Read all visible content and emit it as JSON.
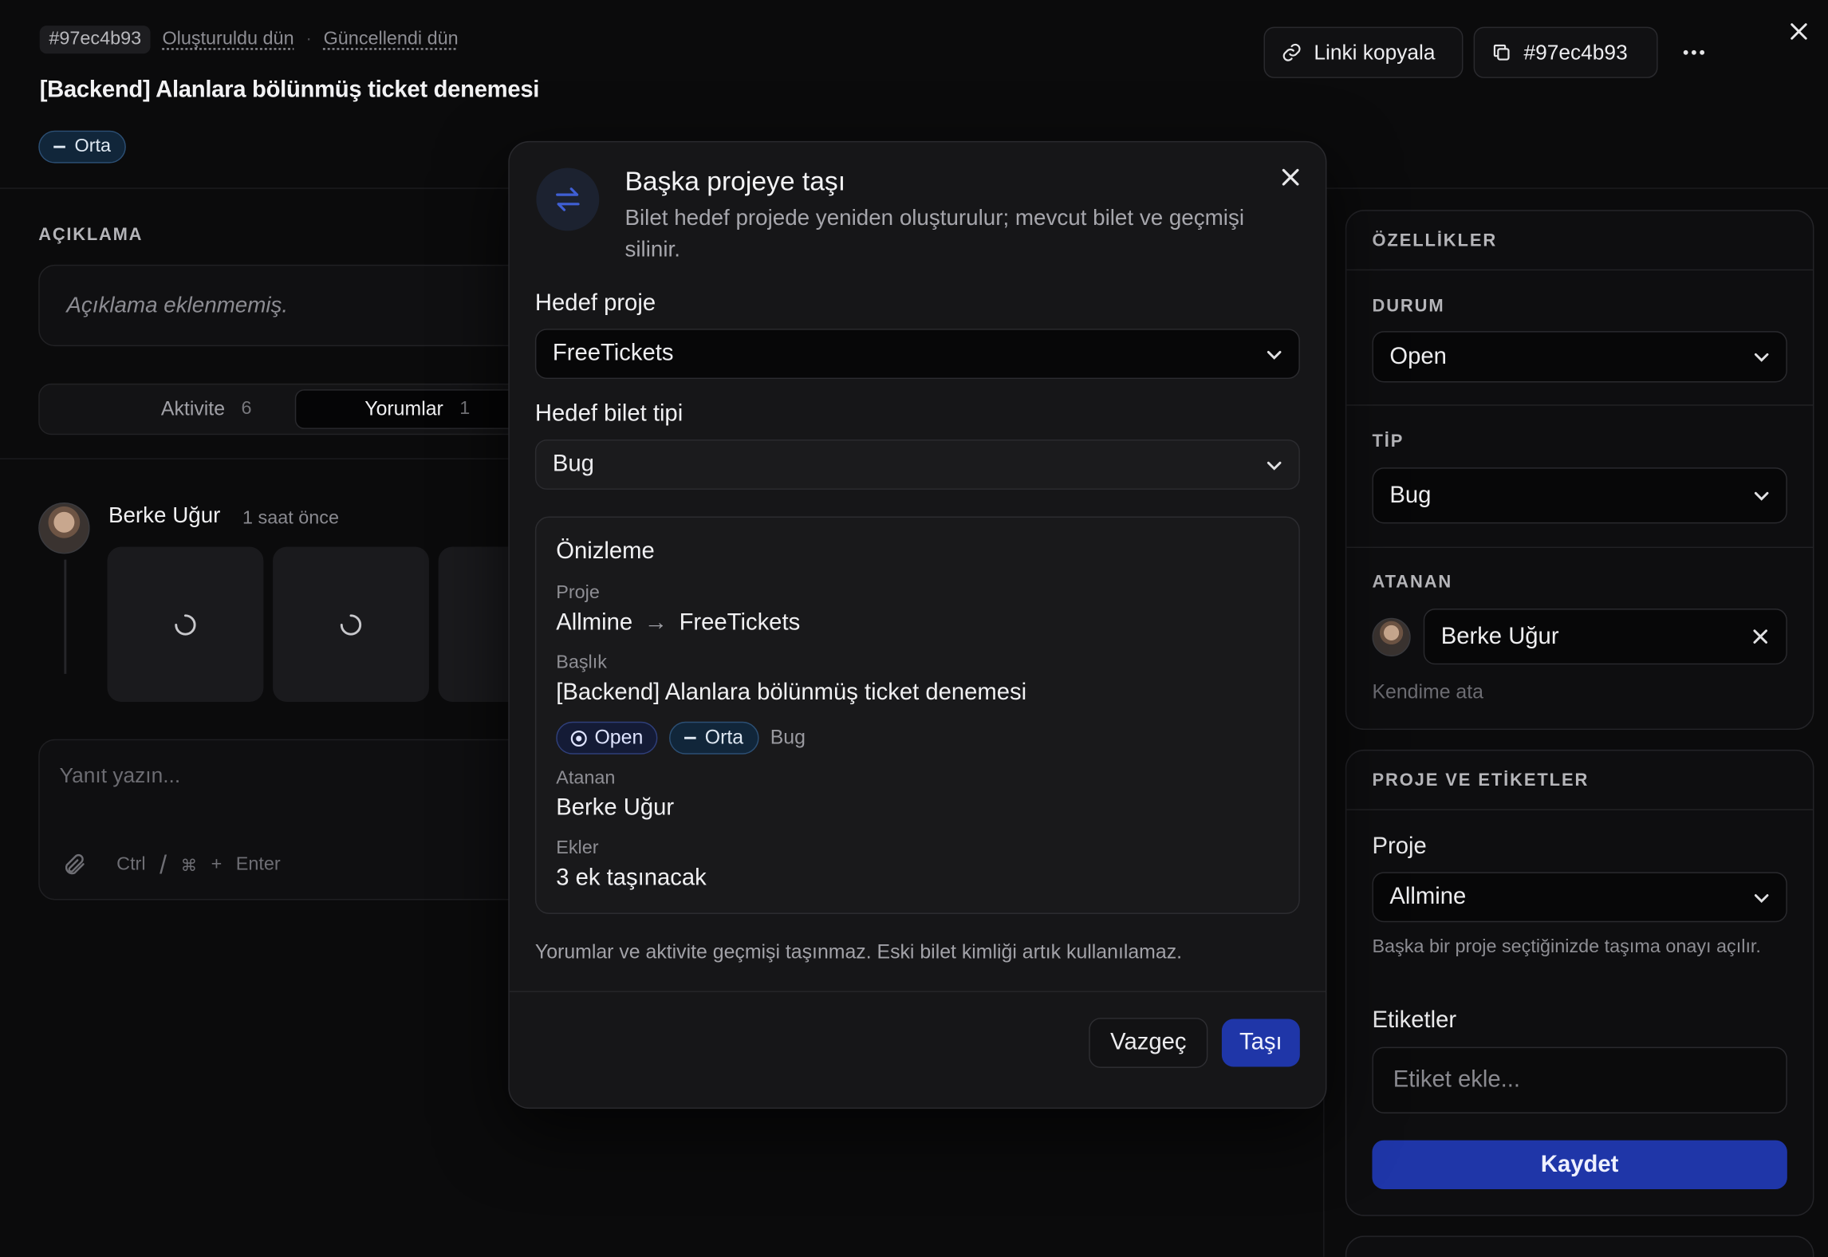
{
  "header": {
    "ticket_id": "#97ec4b93",
    "created": "Oluşturuldu dün",
    "updated": "Güncellendi dün",
    "title": "[Backend] Alanlara bölünmüş ticket denemesi",
    "priority": "Orta",
    "copy_link_label": "Linki kopyala",
    "copy_id_label": "#97ec4b93"
  },
  "description": {
    "label": "AÇIKLAMA",
    "empty_text": "Açıklama eklenmemiş."
  },
  "tabs": [
    {
      "label": "Aktivite",
      "count": "6"
    },
    {
      "label": "Yorumlar",
      "count": "1"
    }
  ],
  "comment": {
    "author": "Berke Uğur",
    "time": "1 saat önce"
  },
  "reply": {
    "placeholder": "Yanıt yazın...",
    "shortcut_ctrl": "Ctrl",
    "shortcut_sep": "/",
    "shortcut_cmd": "⌘",
    "shortcut_plus": "+",
    "shortcut_enter": "Enter"
  },
  "properties": {
    "title": "ÖZELLİKLER",
    "status_label": "DURUM",
    "status_value": "Open",
    "type_label": "TİP",
    "type_value": "Bug",
    "assignee_label": "ATANAN",
    "assignee_value": "Berke Uğur",
    "assign_self": "Kendime ata"
  },
  "project_tags": {
    "title": "PROJE VE ETİKETLER",
    "project_label": "Proje",
    "project_value": "Allmine",
    "project_hint": "Başka bir proje seçtiğinizde taşıma onayı açılır.",
    "tags_label": "Etiketler",
    "tags_placeholder": "Etiket ekle...",
    "save_label": "Kaydet"
  },
  "modal": {
    "title": "Başka projeye taşı",
    "subtitle": "Bilet hedef projede yeniden oluşturulur; mevcut bilet ve geçmişi silinir.",
    "target_project_label": "Hedef proje",
    "target_project_value": "FreeTickets",
    "target_type_label": "Hedef bilet tipi",
    "target_type_value": "Bug",
    "preview": {
      "title": "Önizleme",
      "project_key": "Proje",
      "project_from": "Allmine",
      "project_arrow": "→",
      "project_to": "FreeTickets",
      "title_key": "Başlık",
      "title_value": "[Backend] Alanlara bölünmüş ticket denemesi",
      "status_tag": "Open",
      "priority_tag": "Orta",
      "type_tag": "Bug",
      "assignee_key": "Atanan",
      "assignee_value": "Berke Uğur",
      "attachments_key": "Ekler",
      "attachments_value": "3 ek taşınacak"
    },
    "note": "Yorumlar ve aktivite geçmişi taşınmaz. Eski bilet kimliği artık kullanılamaz.",
    "cancel_label": "Vazgeç",
    "confirm_label": "Taşı"
  },
  "colors": {
    "background": "#0b0b0c",
    "accent": "#1f36a8",
    "priority_border": "#2c4f74"
  }
}
